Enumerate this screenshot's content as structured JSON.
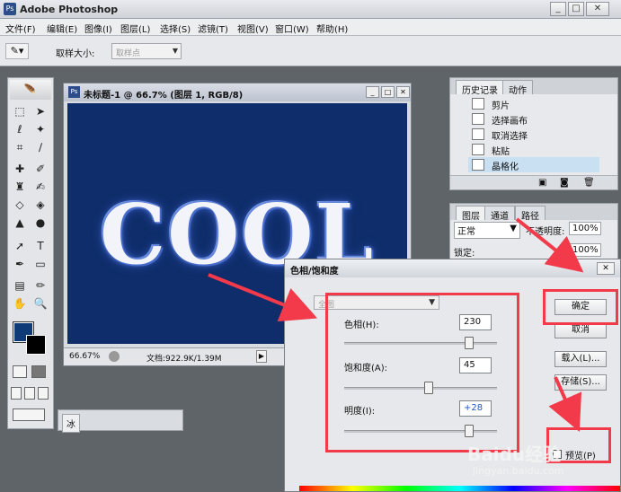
{
  "app": {
    "title": "Adobe Photoshop"
  },
  "menu": [
    "文件(F)",
    "编辑(E)",
    "图像(I)",
    "图层(L)",
    "选择(S)",
    "滤镜(T)",
    "视图(V)",
    "窗口(W)",
    "帮助(H)"
  ],
  "options": {
    "sample_label": "取样大小:",
    "sample_value": "取样点"
  },
  "document": {
    "title": "未标题-1 @ 66.7% (图层 1, RGB/8)",
    "canvas_text": "COOL",
    "zoom": "66.67%",
    "doc_size": "文档:922.9K/1.39M",
    "canvas_color": "#0f2d6a"
  },
  "history": {
    "tabs": [
      "历史记录",
      "动作"
    ],
    "items": [
      "剪片",
      "选择画布",
      "取消选择",
      "粘贴",
      "晶格化"
    ],
    "selected_index": 4
  },
  "layers": {
    "tabs": [
      "图层",
      "通道",
      "路径"
    ],
    "blend_mode": "正常",
    "opacity_label": "不透明度:",
    "opacity_value": "100%",
    "lock_label": "锁定:",
    "fill_value": "100%"
  },
  "mini_tab": {
    "label": "冰"
  },
  "dialog": {
    "title": "色相/饱和度",
    "edit_value": "全图",
    "hue_label": "色相(H):",
    "hue_value": "230",
    "hue_position": 0.82,
    "sat_label": "饱和度(A):",
    "sat_value": "45",
    "sat_position": 0.55,
    "light_label": "明度(I):",
    "light_value": "+28",
    "light_position": 0.82,
    "ok": "确定",
    "cancel": "取消",
    "load": "载入(L)...",
    "save": "存储(S)...",
    "preview": "预览(P)"
  },
  "colors": {
    "fg": "#0e3b78",
    "bg": "#000000",
    "annotation": "#f23a4a"
  },
  "watermark": {
    "brand": "Baidu经验",
    "url": "jingyan.baidu.com"
  }
}
